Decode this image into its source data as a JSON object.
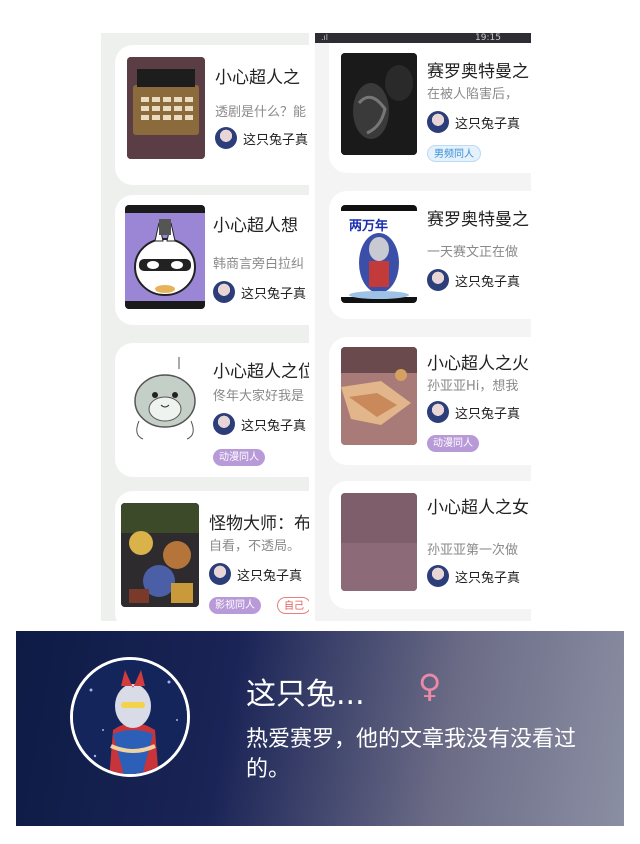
{
  "status_bar": {
    "signal": ".ıl",
    "time": "19:15"
  },
  "left_column": {
    "cards": [
      {
        "title": "小心超人之",
        "snippet": "透剧是什么？能",
        "author": "这只兔子真",
        "tags": []
      },
      {
        "title": "小心超人想",
        "snippet": "韩商言旁白拉纠",
        "author": "这只兔子真",
        "tags": []
      },
      {
        "title": "小心超人之位",
        "snippet": "佟年大家好我是",
        "author": "这只兔子真",
        "tags": [
          "动漫同人"
        ]
      },
      {
        "title": "怪物大师：布",
        "snippet": "自看，不透局。",
        "author": "这只兔子真",
        "tags": [
          "影视同人",
          "自己"
        ]
      }
    ]
  },
  "right_column": {
    "cards": [
      {
        "title": "赛罗奥特曼之",
        "snippet": "在被人陷害后，",
        "author": "这只兔子真",
        "tags": [
          "男频同人"
        ]
      },
      {
        "title": "赛罗奥特曼之",
        "snippet": "一天赛文正在做",
        "author": "这只兔子真",
        "thumb_text": "两万年",
        "tags": []
      },
      {
        "title": "小心超人之火",
        "snippet": "孙亚亚Hi，想我",
        "author": "这只兔子真",
        "tags": [
          "动漫同人"
        ]
      },
      {
        "title": "小心超人之女",
        "snippet": "孙亚亚第一次做",
        "author": "这只兔子真",
        "tags": []
      }
    ]
  },
  "profile": {
    "name": "这只兔...",
    "gender_symbol": "♀",
    "bio": "热爱赛罗，他的文章我没有没看过的。"
  },
  "colors": {
    "tag_purple": "#b99ad9",
    "tag_blue": "#3a90d8",
    "tag_red": "#e05a5a",
    "gender_pink": "#e98aa7"
  }
}
